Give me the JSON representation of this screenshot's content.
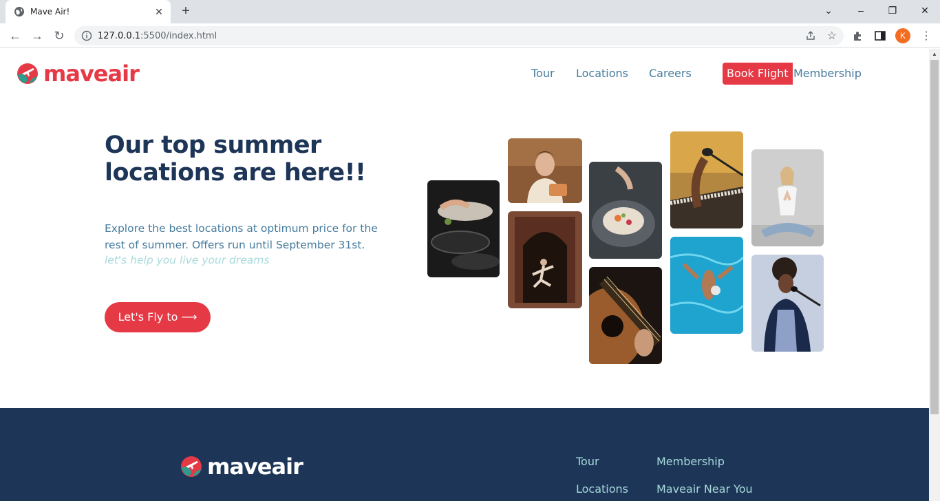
{
  "browser": {
    "tab_title": "Mave Air!",
    "url_host": "127.0.0.1",
    "url_rest": ":5500/index.html",
    "profile_initial": "K"
  },
  "header": {
    "logo_text": "maveair",
    "nav": [
      "Tour",
      "Locations",
      "Careers"
    ],
    "book_label": "Book Flight",
    "membership_label": "Membership"
  },
  "hero": {
    "title": "Our top summer locations are here!!",
    "description": "Explore the best locations at optimum price for the rest of summer. Offers run until September 31st.",
    "tagline": "let's help you live your dreams",
    "cta_label": "Let's Fly to ⟶"
  },
  "gallery": [
    {
      "name": "cooking-photo"
    },
    {
      "name": "baker-photo"
    },
    {
      "name": "dancer-doorway-photo"
    },
    {
      "name": "plated-dish-photo"
    },
    {
      "name": "guitar-photo"
    },
    {
      "name": "keyboard-mic-photo"
    },
    {
      "name": "swimmer-photo"
    },
    {
      "name": "yoga-photo"
    },
    {
      "name": "singer-photo"
    }
  ],
  "footer": {
    "logo_text": "maveair",
    "links_col1": [
      "Tour",
      "Locations"
    ],
    "links_col2": [
      "Membership",
      "Maveair Near You"
    ]
  },
  "colors": {
    "brand_red": "#e63946",
    "navy": "#1d3557",
    "link_blue": "#457b9d",
    "light_teal": "#a8dadc"
  }
}
